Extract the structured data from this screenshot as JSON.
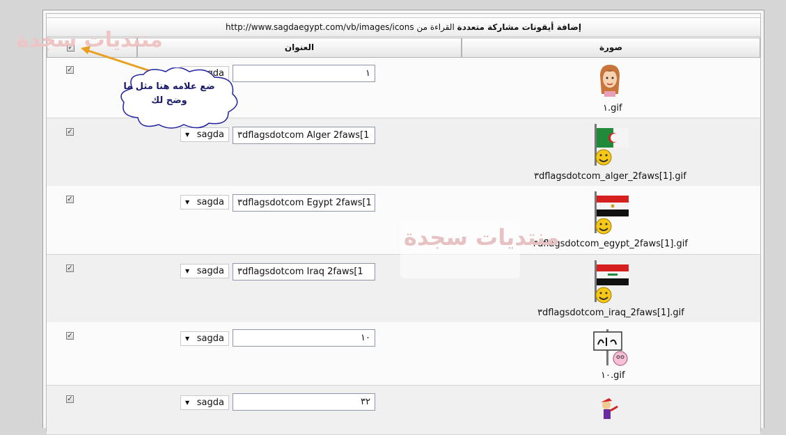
{
  "header": {
    "title_bold": "إضافة أيقونات مشاركة متعددة",
    "title_mid": "القراءة من",
    "url": "http://www.sagdaegypt.com/vb/images/icons"
  },
  "columns": {
    "image": "صورة",
    "title": "العنوان",
    "select_all_checked": true
  },
  "rows": [
    {
      "file": "١.gif",
      "title_value": "١",
      "category": "sagda",
      "checked": true,
      "icon": "girl-face-icon"
    },
    {
      "file": "٣dflags­dotcom_alger_2faws[1].gif",
      "title_value": "٣dflagsdotcom Alger 2faws[1",
      "category": "sagda",
      "checked": true,
      "icon": "algeria-flag-smiley-icon"
    },
    {
      "file": "٣dflagsdotcom_egypt_2faws[1].gif",
      "title_value": "٣dflagsdotcom Egypt 2faws[1",
      "category": "sagda",
      "checked": true,
      "icon": "egypt-flag-smiley-icon"
    },
    {
      "file": "٣dflagsdotcom_iraq_2faws[1].gif",
      "title_value": "٣dflagsdotcom Iraq 2faws[1",
      "category": "sagda",
      "checked": true,
      "icon": "iraq-flag-smiley-icon"
    },
    {
      "file": "١٠.gif",
      "title_value": "١٠",
      "category": "sagda",
      "checked": true,
      "icon": "no-comment-sign-icon"
    },
    {
      "file": "",
      "title_value": "٣٢",
      "category": "sagda",
      "checked": true,
      "icon": "character-icon"
    }
  ],
  "callout": {
    "line1": "ضع علامه هنا مثل ما",
    "line2": "وضح لك"
  },
  "watermark": {
    "text": "منتديات سجدة"
  },
  "colors": {
    "arrow": "#e8a020",
    "watermark": "#e9b9b9",
    "bubble_border": "#2020a0"
  }
}
